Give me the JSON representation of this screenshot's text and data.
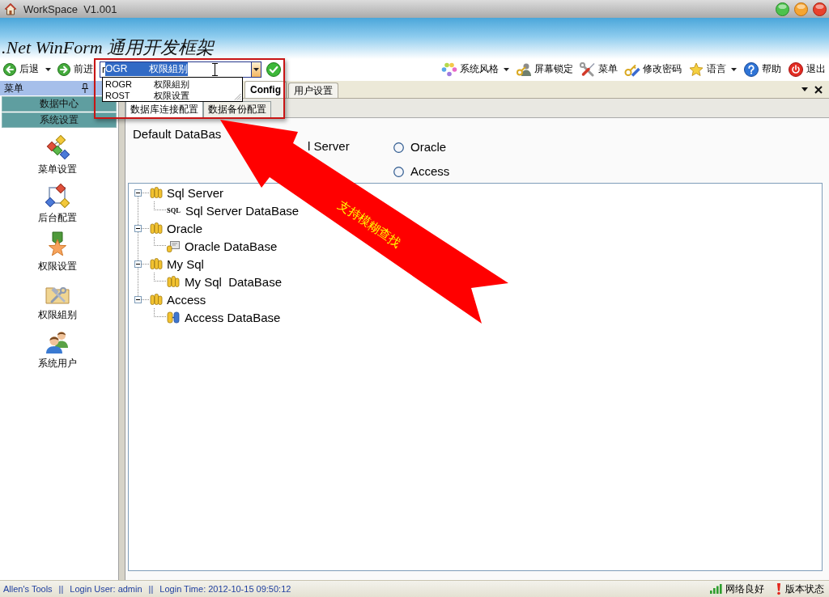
{
  "window": {
    "title": "WorkSpace  V1.001"
  },
  "banner": {
    "title": ".Net WinForm 通用开发框架"
  },
  "toolbar": {
    "nav": [
      {
        "kind": "back",
        "label": "后退",
        "dropdown": true
      },
      {
        "kind": "forward",
        "label": "前进",
        "dropdown": false
      }
    ],
    "search": {
      "typed": "r",
      "completion": "OGR        权限組别"
    },
    "suggestions": [
      {
        "code": "ROGR",
        "name": "权限組别"
      },
      {
        "code": "ROST",
        "name": "权限设置"
      }
    ],
    "tools": [
      {
        "kind": "theme",
        "label": "系统风格",
        "dropdown": true
      },
      {
        "kind": "lock",
        "label": "屏幕锁定",
        "dropdown": false
      },
      {
        "kind": "menu",
        "label": "菜单",
        "dropdown": false
      },
      {
        "kind": "password",
        "label": "修改密码",
        "dropdown": false
      },
      {
        "kind": "language",
        "label": "语言",
        "dropdown": true
      },
      {
        "kind": "help",
        "label": "帮助",
        "dropdown": false
      },
      {
        "kind": "exit",
        "label": "退出",
        "dropdown": false
      }
    ]
  },
  "sidebar": {
    "title": "菜单",
    "sections": [
      "数据中心",
      "系统设置"
    ],
    "items": [
      {
        "kind": "network",
        "label": "菜单设置"
      },
      {
        "kind": "frame",
        "label": "后台配置"
      },
      {
        "kind": "medal",
        "label": "权限设置"
      },
      {
        "kind": "toolbox",
        "label": "权限組别"
      },
      {
        "kind": "users",
        "label": "系统用户"
      }
    ]
  },
  "tabs": [
    {
      "label": "Config",
      "selected": true
    },
    {
      "label": "用户设置",
      "selected": false
    }
  ],
  "subtabs": [
    {
      "label": "数据库连接配置",
      "selected": true
    },
    {
      "label": "数据备份配置",
      "selected": false
    }
  ],
  "database_settings": {
    "label": "Default DataBas",
    "covered_option": "l Server",
    "options": [
      {
        "label": "Oracle",
        "selected": false
      },
      {
        "label": "Access",
        "selected": false
      }
    ]
  },
  "tree": [
    {
      "label": "Sql Server",
      "expanded": true,
      "children": [
        {
          "kind": "label",
          "icon_text": "SQL",
          "label": "Sql Server DataBase"
        }
      ]
    },
    {
      "label": "Oracle",
      "expanded": true,
      "children": [
        {
          "kind": "window",
          "label": "Oracle DataBase"
        }
      ]
    },
    {
      "label": "My Sql",
      "expanded": true,
      "children": [
        {
          "kind": "cylinders",
          "label": "My Sql  DataBase"
        }
      ]
    },
    {
      "label": "Access",
      "expanded": true,
      "children": [
        {
          "kind": "linked",
          "label": "Access DataBase"
        }
      ]
    }
  ],
  "annotation": {
    "text": "支持模糊查找"
  },
  "status_bar": {
    "left": [
      {
        "text": "Allen's Tools"
      },
      {
        "separator": "||",
        "text": "Login User: admin"
      },
      {
        "separator": "||",
        "text": "Login Time: 2012-10-15 09:50:12"
      }
    ],
    "network": "网络良好",
    "version": "版本状态"
  }
}
